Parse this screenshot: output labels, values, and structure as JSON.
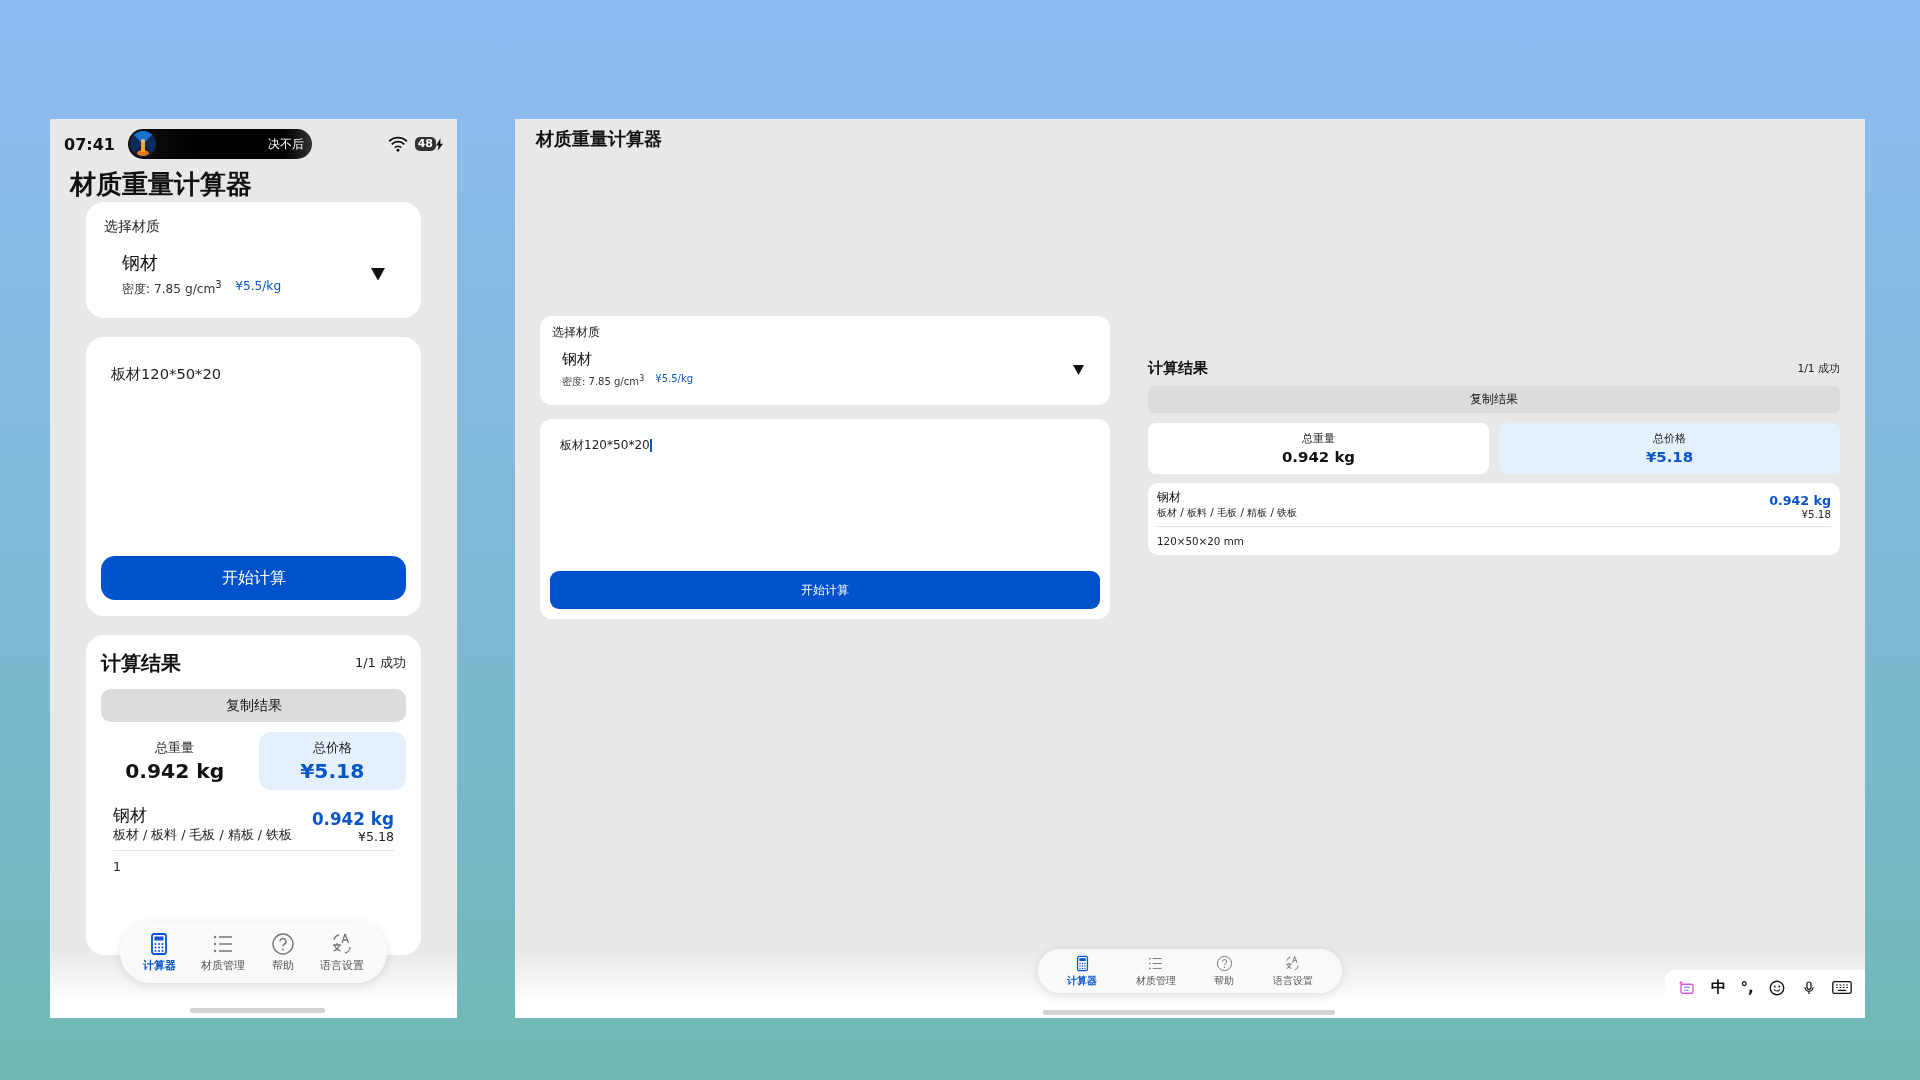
{
  "phone": {
    "status_bar": {
      "time": "07:41",
      "live_activity": "决不后",
      "battery": "48"
    },
    "title": "材质重量计算器",
    "material_select": {
      "label": "选择材质",
      "name": "钢材",
      "density": "密度: 7.85 g/cm$^{3}$",
      "price": "¥5.5/kg"
    },
    "input": {
      "value": "板材120*50*20",
      "focused": false
    },
    "calculate_button": "开始计算",
    "results": {
      "title": "计算结果",
      "summary": "1/1 成功",
      "copy_button": "复制结果",
      "stats": [
        {
          "label": "总重量",
          "value": "0.942 kg",
          "kind": "weight"
        },
        {
          "label": "总价格",
          "value": "¥5.18",
          "kind": "price"
        }
      ],
      "items": [
        {
          "name": "钢材",
          "aliases": "板材 / 板料 / 毛板 / 精板 / 铁板",
          "weight": "0.942 kg",
          "price": "¥5.18",
          "dimensions": "1"
        }
      ]
    },
    "nav_tabs": [
      {
        "label": "计算器",
        "selected": true
      },
      {
        "label": "材质管理",
        "selected": false
      },
      {
        "label": "帮助",
        "selected": false
      },
      {
        "label": "语言设置",
        "selected": false
      }
    ]
  },
  "tablet": {
    "title": "材质重量计算器",
    "material_select": {
      "label": "选择材质",
      "name": "钢材",
      "density": "密度: 7.85 g/cm$^{3}$",
      "price": "¥5.5/kg"
    },
    "input": {
      "value": "板材120*50*20",
      "focused": true
    },
    "calculate_button": "开始计算",
    "results": {
      "title": "计算结果",
      "summary": "1/1 成功",
      "copy_button": "复制结果",
      "stats": [
        {
          "label": "总重量",
          "value": "0.942 kg",
          "kind": "weight"
        },
        {
          "label": "总价格",
          "value": "¥5.18",
          "kind": "price"
        }
      ],
      "items": [
        {
          "name": "钢材",
          "aliases": "板材 / 板料 / 毛板 / 精板 / 铁板",
          "weight": "0.942 kg",
          "price": "¥5.18",
          "dimensions": "120×50×20 mm"
        }
      ]
    },
    "nav_tabs": [
      {
        "label": "计算器",
        "selected": true
      },
      {
        "label": "材质管理",
        "selected": false
      },
      {
        "label": "帮助",
        "selected": false
      },
      {
        "label": "语言设置",
        "selected": false
      }
    ],
    "ime_toolbar": {
      "language": "中",
      "punctuation": "°,"
    }
  }
}
